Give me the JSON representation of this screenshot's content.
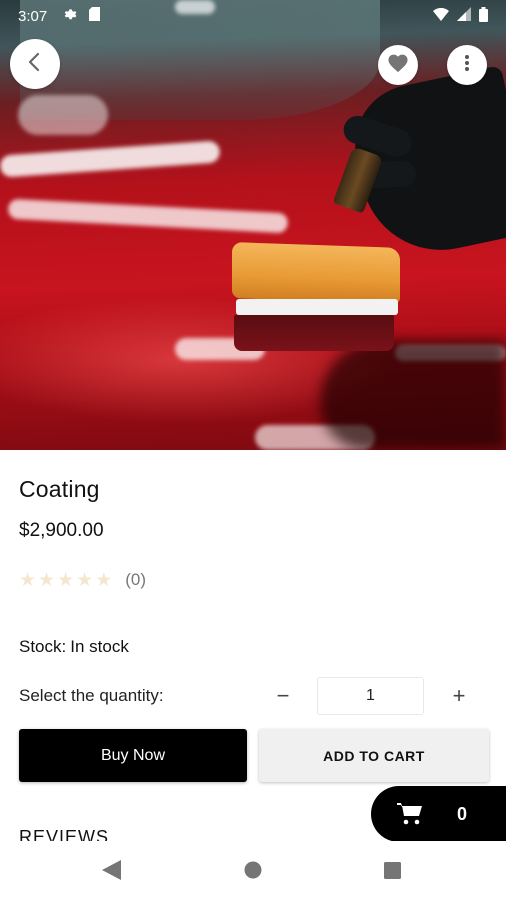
{
  "status_bar": {
    "time": "3:07",
    "icons": [
      "settings-icon",
      "sd-card-icon",
      "wifi-icon",
      "signal-icon",
      "battery-icon"
    ]
  },
  "hero": {
    "description_icons": [
      "back-arrow-icon",
      "heart-icon",
      "more-vertical-icon"
    ]
  },
  "product": {
    "title": "Coating",
    "price": "$2,900.00",
    "rating": {
      "value": 0,
      "max": 5,
      "stars": [
        "★",
        "★",
        "★",
        "★",
        "★"
      ],
      "count_text": "(0)"
    },
    "stock_label": "Stock:",
    "stock_value": "In stock"
  },
  "quantity": {
    "label": "Select the quantity:",
    "minus": "−",
    "plus": "+",
    "value": "1"
  },
  "actions": {
    "buy_now": "Buy Now",
    "add_to_cart": "ADD TO CART"
  },
  "reviews": {
    "heading": "REVIEWS"
  },
  "cart": {
    "count": "0"
  },
  "colors": {
    "primary": "#000000",
    "secondary_button": "#f0f0f0",
    "star_inactive": "#f5e7cf"
  }
}
